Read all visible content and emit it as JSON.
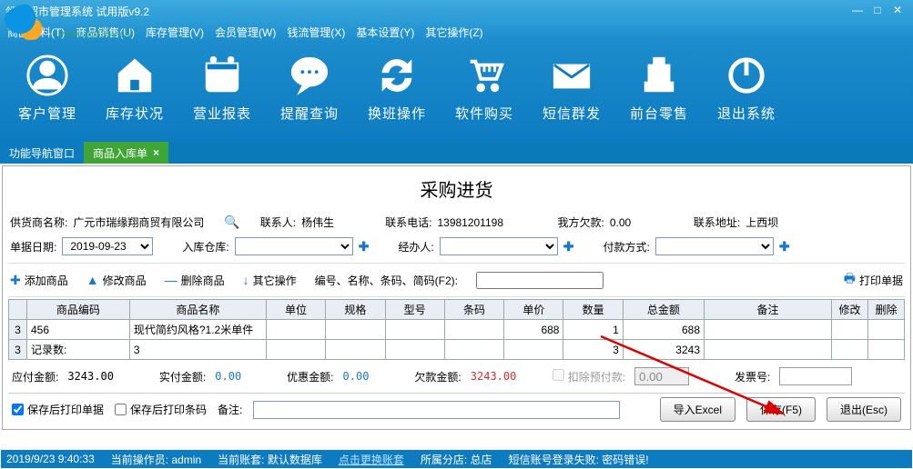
{
  "window": {
    "title": "领智超市管理系统 试用版v9.2"
  },
  "menu": {
    "m0": "商品资料(T)",
    "m1": "商品销售(U)",
    "m2": "库存管理(V)",
    "m3": "会员管理(W)",
    "m4": "钱流管理(X)",
    "m5": "基本设置(Y)",
    "m6": "其它操作(Z)"
  },
  "toolbar": {
    "b0": "客户管理",
    "b1": "库存状况",
    "b2": "营业报表",
    "b3": "提醒查询",
    "b4": "换班操作",
    "b5": "软件购买",
    "b6": "短信群发",
    "b7": "前台零售",
    "b8": "退出系统"
  },
  "tabs": {
    "t0": "功能导航窗口",
    "t1": "商品入库单"
  },
  "page": {
    "title": "采购进货",
    "supplier_lbl": "供货商名称:",
    "supplier_val": "广元市瑞缘翔商贸有限公司",
    "contact_lbl": "联系人:",
    "contact_val": "杨伟生",
    "phone_lbl": "联系电话:",
    "phone_val": "13981201198",
    "mydebt_lbl": "我方欠款:",
    "mydebt_val": "0.00",
    "addr_lbl": "联系地址:",
    "addr_val": "上西坝",
    "date_lbl": "单据日期:",
    "date_val": "2019-09-23",
    "wh_lbl": "入库仓库:",
    "wh_val": "",
    "handler_lbl": "经办人:",
    "handler_val": "",
    "payway_lbl": "付款方式:",
    "payway_val": ""
  },
  "actions": {
    "add": "添加商品",
    "edit": "修改商品",
    "del": "删除商品",
    "other": "其它操作",
    "search_lbl": "编号、名称、条码、简码(F2):",
    "print": "打印单据"
  },
  "grid": {
    "hdr": {
      "c0": "商品编码",
      "c1": "商品名称",
      "c2": "单位",
      "c3": "规格",
      "c4": "型号",
      "c5": "条码",
      "c6": "单价",
      "c7": "数量",
      "c8": "总金额",
      "c9": "备注",
      "c10": "修改",
      "c11": "删除"
    },
    "row1": {
      "idx": "3",
      "code": "456",
      "name": "现代简约风格?1.2米单件",
      "price": "688",
      "qty": "1",
      "amt": "688"
    },
    "sum": {
      "idx": "3",
      "lbl": "记录数:",
      "cnt": "3",
      "qty": "3",
      "amt": "3243"
    }
  },
  "amounts": {
    "due_lbl": "应付金额:",
    "due_val": "3243.00",
    "paid_lbl": "实付金额:",
    "paid_val": "0.00",
    "disc_lbl": "优惠金额:",
    "disc_val": "0.00",
    "owe_lbl": "欠款金额:",
    "owe_val": "3243.00",
    "prepay_lbl": "扣除预付款:",
    "prepay_val": "0.00",
    "invoice_lbl": "发票号:",
    "invoice_val": ""
  },
  "footer": {
    "cb1": "保存后打印单据",
    "cb2": "保存后打印条码",
    "remark_lbl": "备注:",
    "btn_excel": "导入Excel",
    "btn_save": "保存(F5)",
    "btn_exit": "退出(Esc)"
  },
  "status": {
    "time": "2019/9/23 9:40:33",
    "op_lbl": "当前操作员:",
    "op_val": "admin",
    "acct_lbl": "当前账套:",
    "acct_val": "默认数据库",
    "switch": "点击更换账套",
    "branch_lbl": "所属分店:",
    "branch_val": "总店",
    "sms": "短信账号登录失败: 密码错误!"
  }
}
